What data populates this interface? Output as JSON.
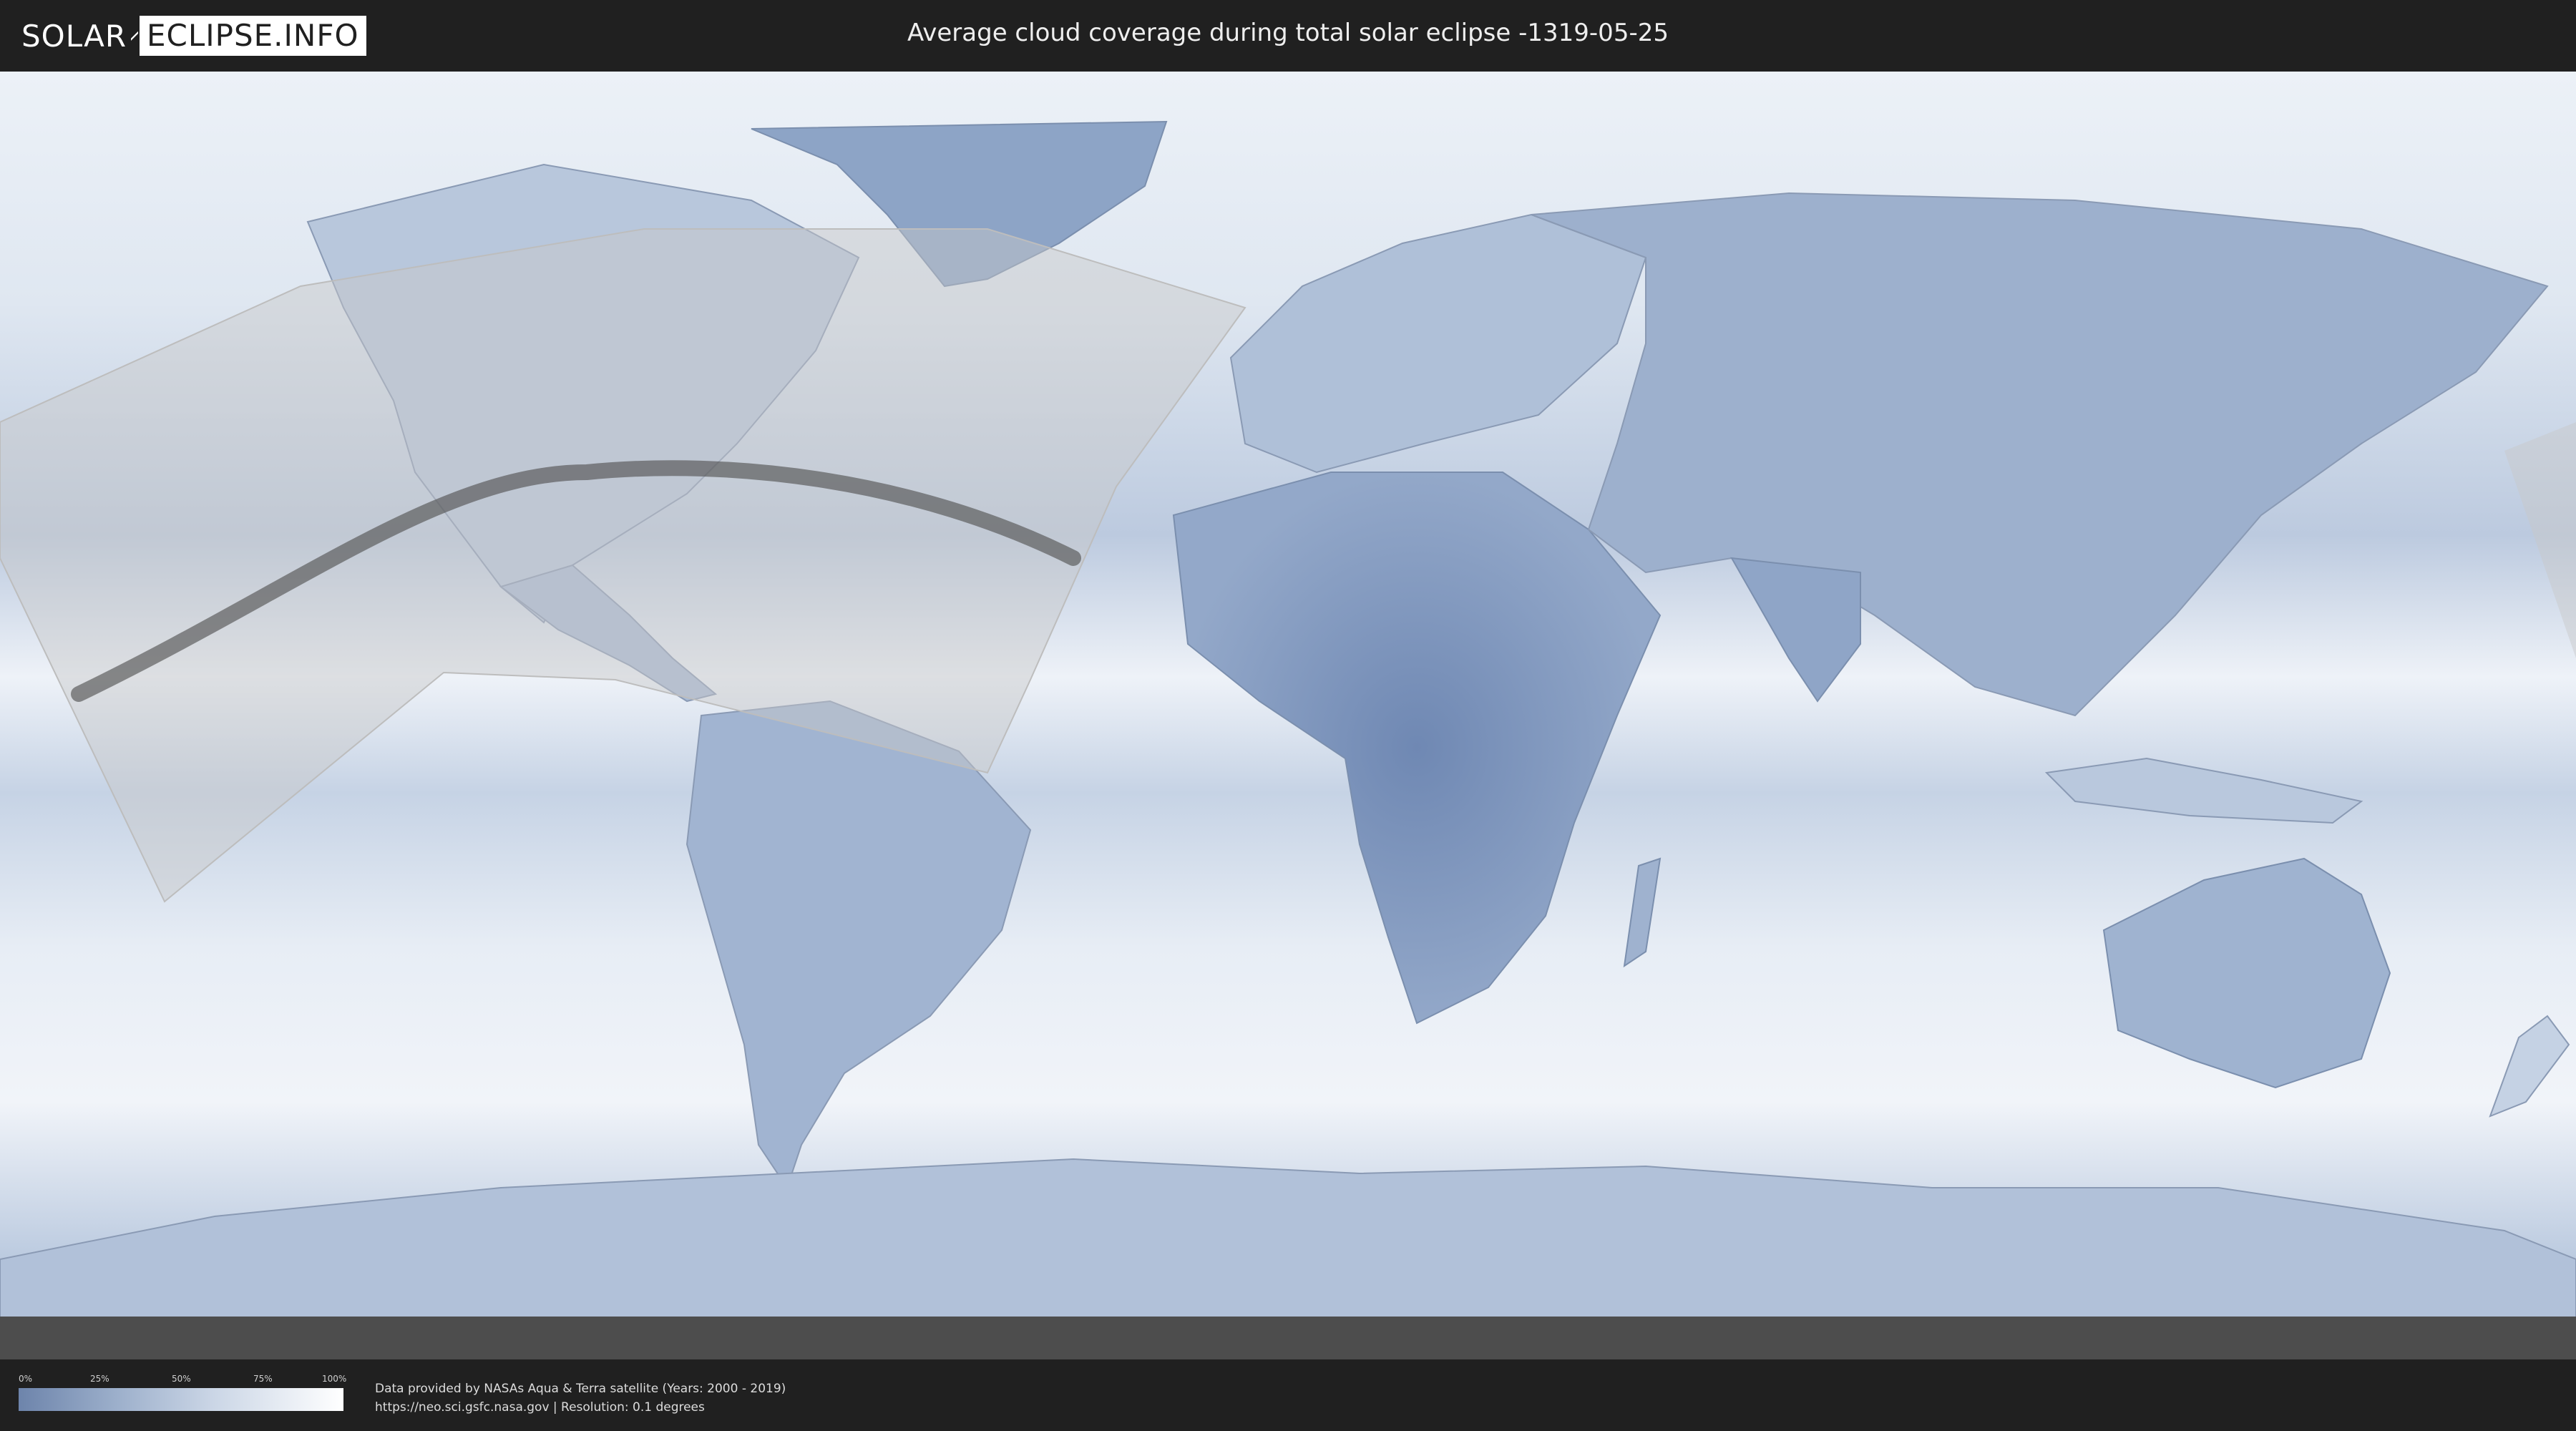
{
  "header": {
    "logo_left": "SOLAR",
    "logo_right": "ECLIPSE.INFO",
    "title": "Average cloud coverage during total solar eclipse -1319-05-25"
  },
  "map": {
    "projection": "equirectangular",
    "layer": "average cloud coverage",
    "colors": {
      "clear_sky": "#5f7aa8",
      "mid": "#a9bbd6",
      "overcast": "#ffffff",
      "eclipse_zone_overlay": "#c8c8c8",
      "totality_path": "#555555",
      "ocean_base": "#d6e1ee"
    }
  },
  "legend": {
    "ticks": [
      "0%",
      "25%",
      "50%",
      "75%",
      "100%"
    ]
  },
  "footer": {
    "line1": "Data provided by NASAs Aqua & Terra satellite (Years: 2000 - 2019)",
    "line2": "https://neo.sci.gsfc.nasa.gov | Resolution: 0.1 degrees"
  }
}
